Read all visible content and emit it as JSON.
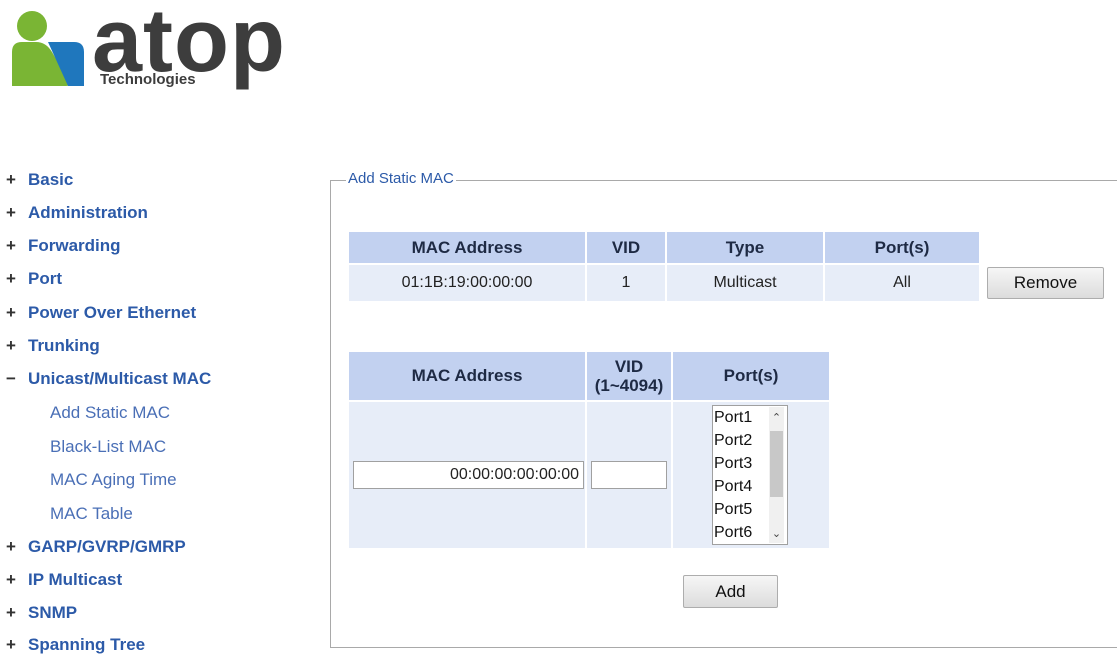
{
  "logo": {
    "text": "atop",
    "subtext": "Technologies",
    "colors": {
      "green": "#7ab534",
      "blue": "#1f77bd",
      "text": "#3d3d3d"
    }
  },
  "sidebar": {
    "items": [
      {
        "sign": "+",
        "label": "Basic"
      },
      {
        "sign": "+",
        "label": "Administration"
      },
      {
        "sign": "+",
        "label": "Forwarding"
      },
      {
        "sign": "+",
        "label": "Port"
      },
      {
        "sign": "+",
        "label": "Power Over Ethernet"
      },
      {
        "sign": "+",
        "label": "Trunking"
      },
      {
        "sign": "−",
        "label": "Unicast/Multicast MAC"
      },
      {
        "sign": "+",
        "label": "GARP/GVRP/GMRP"
      },
      {
        "sign": "+",
        "label": "IP Multicast"
      },
      {
        "sign": "+",
        "label": "SNMP"
      },
      {
        "sign": "+",
        "label": "Spanning Tree"
      }
    ],
    "subitems": [
      {
        "label": "Add Static MAC"
      },
      {
        "label": "Black-List MAC"
      },
      {
        "label": "MAC Aging Time"
      },
      {
        "label": "MAC Table"
      }
    ]
  },
  "main": {
    "legend": "Add Static MAC",
    "existing_table": {
      "headers": [
        "MAC Address",
        "VID",
        "Type",
        "Port(s)"
      ],
      "rows": [
        {
          "mac": "01:1B:19:00:00:00",
          "vid": "1",
          "type": "Multicast",
          "ports": "All"
        }
      ],
      "remove_label": "Remove"
    },
    "add_table": {
      "headers": {
        "mac": "MAC Address",
        "vid_line1": "VID",
        "vid_line2": "(1~4094)",
        "ports": "Port(s)"
      },
      "mac_value": "00:00:00:00:00:00",
      "vid_value": "",
      "port_options": [
        "Port1",
        "Port2",
        "Port3",
        "Port4",
        "Port5",
        "Port6"
      ],
      "add_label": "Add"
    }
  },
  "colors": {
    "nav_link": "#2c5aa8",
    "header_bg": "#c2d1f0",
    "cell_bg": "#e7edf8"
  }
}
